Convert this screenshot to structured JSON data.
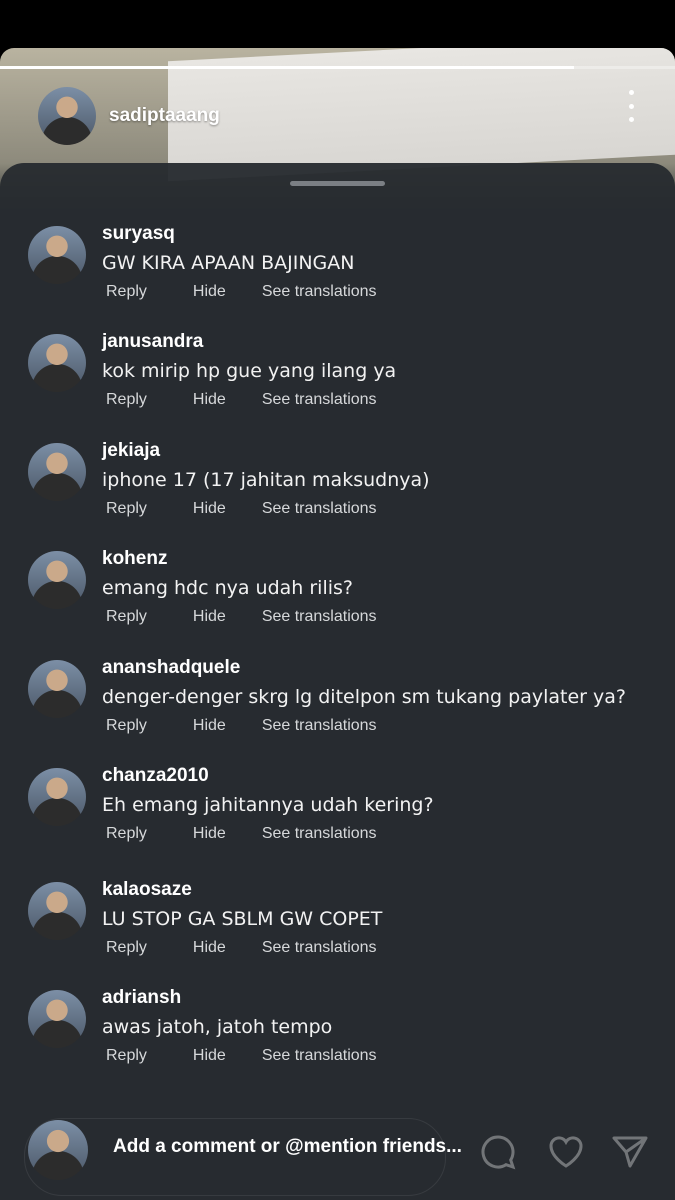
{
  "story": {
    "username": "sadiptaaang",
    "progress": 0.85
  },
  "comments": [
    {
      "user": "suryasq",
      "text": "GW KIRA APAAN BAJINGAN"
    },
    {
      "user": "janusandra",
      "text": "kok mirip hp gue yang ilang ya"
    },
    {
      "user": "jekiaja",
      "text": "iphone 17 (17 jahitan maksudnya)"
    },
    {
      "user": "kohenz",
      "text": "emang hdc nya udah rilis?"
    },
    {
      "user": "ananshadquele",
      "text": "denger-denger skrg lg ditelpon sm tukang paylater ya?"
    },
    {
      "user": "chanza2010",
      "text": "Eh emang jahitannya udah kering?"
    },
    {
      "user": "kalaosaze",
      "text": "LU STOP GA SBLM GW COPET"
    },
    {
      "user": "adriansh",
      "text": "awas jatoh, jatoh tempo"
    }
  ],
  "actions": {
    "reply": "Reply",
    "hide": "Hide",
    "translate": "See translations"
  },
  "composer": {
    "placeholder": "Add a comment or @mention friends..."
  },
  "icons": {
    "more": "more-vertical-icon",
    "comment": "comment-bubble-icon",
    "like": "heart-icon",
    "share": "send-icon"
  }
}
